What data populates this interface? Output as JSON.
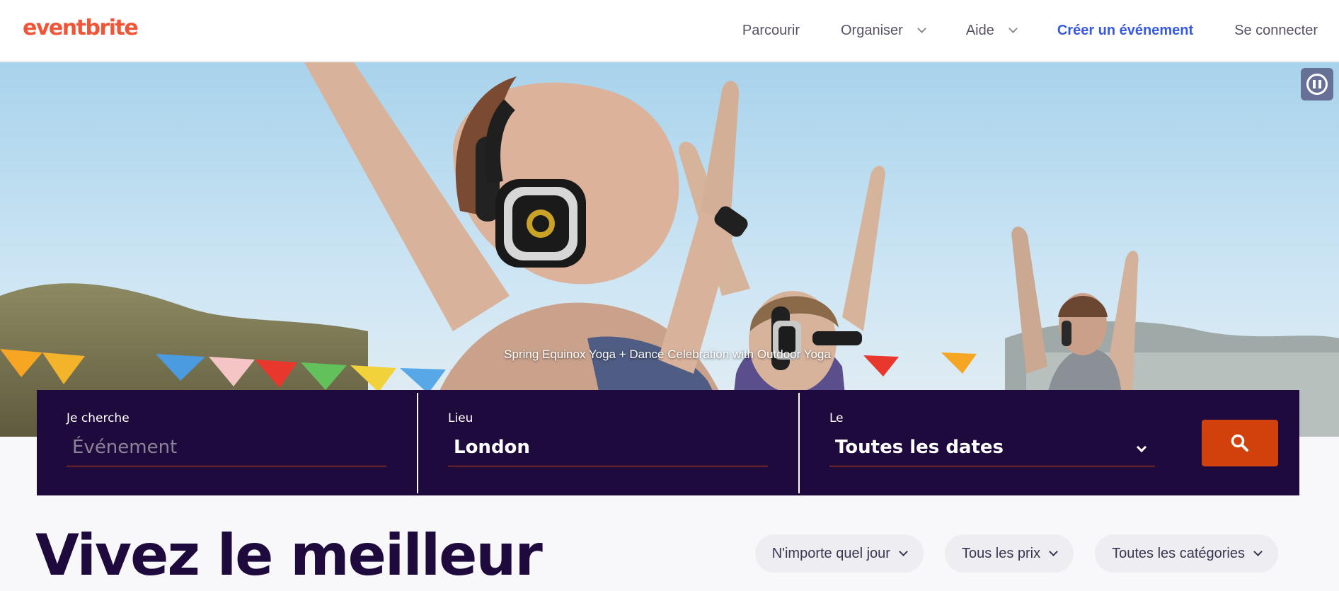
{
  "header": {
    "logo": "eventbrite",
    "nav": [
      {
        "label": "Parcourir",
        "dropdown": false
      },
      {
        "label": "Organiser",
        "dropdown": true
      },
      {
        "label": "Aide",
        "dropdown": true
      },
      {
        "label": "Créer un événement",
        "dropdown": false,
        "accent": true
      },
      {
        "label": "Se connecter",
        "dropdown": false
      }
    ]
  },
  "hero": {
    "caption": "Spring Equinox Yoga + Dance Celebration with Outdoor Yoga",
    "pause_icon": "pause-icon"
  },
  "search": {
    "what_label": "Je cherche",
    "what_placeholder": "Événement",
    "where_label": "Lieu",
    "where_value": "London",
    "when_label": "Le",
    "when_value": "Toutes les dates",
    "submit_icon": "search-icon"
  },
  "main": {
    "headline": "Vivez le meilleur",
    "filters": [
      "N'importe quel jour",
      "Tous les prix",
      "Toutes les catégories"
    ]
  },
  "colors": {
    "brand": "#f05537",
    "accent": "#3659e3",
    "search_bg": "#1e0a3c",
    "search_button": "#d1410c"
  }
}
